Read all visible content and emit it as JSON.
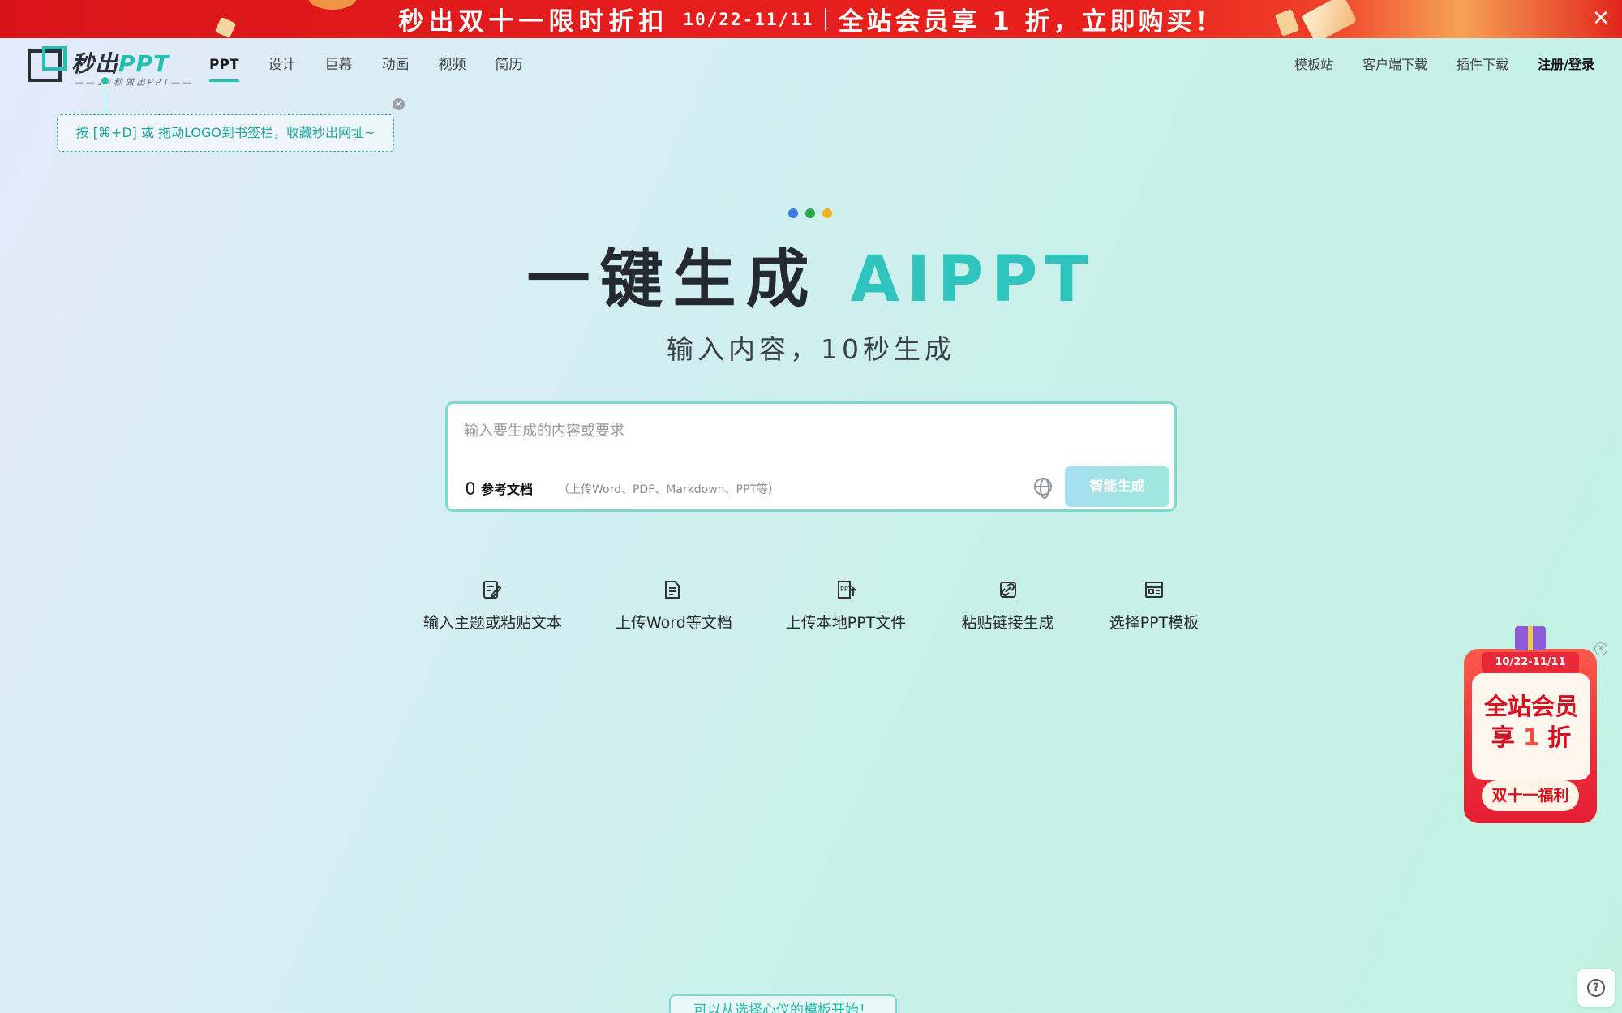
{
  "banner": {
    "main": "秒出双十一限时折扣",
    "date": "10/22-11/11",
    "offer": "全站会员享 1 折，立即购买！",
    "close": "✕"
  },
  "logo": {
    "name_cn": "秒出",
    "name_en": "PPT",
    "tagline": "——10秒做出PPT——"
  },
  "nav": {
    "items": [
      {
        "label": "PPT",
        "active": true
      },
      {
        "label": "设计"
      },
      {
        "label": "巨幕"
      },
      {
        "label": "动画"
      },
      {
        "label": "视频"
      },
      {
        "label": "简历"
      }
    ],
    "right": [
      "模板站",
      "客户端下载",
      "插件下载",
      "注册/登录"
    ]
  },
  "bookmark_tip": {
    "text": "按 [⌘+D] 或 拖动LOGO到书签栏，收藏秒出网址~",
    "close": "✕"
  },
  "hero": {
    "dots": [
      "#3b7bea",
      "#2ba84a",
      "#f2b21b"
    ],
    "title_main": "一键生成 ",
    "title_accent": "AIPPT",
    "subtitle": "输入内容，10秒生成"
  },
  "input_card": {
    "placeholder": "输入要生成的内容或要求",
    "attach_label": "参考文档",
    "attach_hint": "（上传Word、PDF、Markdown、PPT等）",
    "generate_label": "智能生成"
  },
  "options": [
    {
      "label": "输入主题或粘贴文本",
      "icon": "edit-doc-icon"
    },
    {
      "label": "上传Word等文档",
      "icon": "word-doc-icon"
    },
    {
      "label": "上传本地PPT文件",
      "icon": "ppt-upload-icon"
    },
    {
      "label": "粘贴链接生成",
      "icon": "link-icon"
    },
    {
      "label": "选择PPT模板",
      "icon": "template-icon"
    }
  ],
  "promo": {
    "date": "10/22-11/11",
    "line1": "全站会员",
    "line2_pre": "享 ",
    "line2_num": "1",
    "line2_post": " 折",
    "button": "双十一福利",
    "close": "✕"
  },
  "bottom_tab": "可以从选择心仪的模板开始！",
  "help": "?"
}
